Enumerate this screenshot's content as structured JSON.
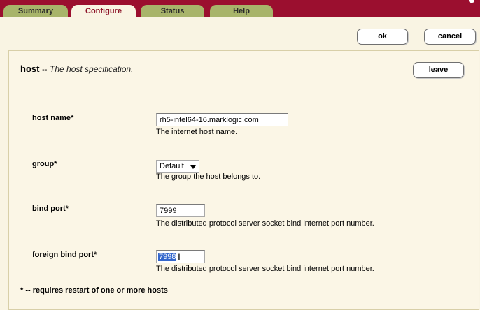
{
  "tabs": [
    {
      "label": "Summary",
      "active": false
    },
    {
      "label": "Configure",
      "active": true
    },
    {
      "label": "Status",
      "active": false
    },
    {
      "label": "Help",
      "active": false
    }
  ],
  "actions": {
    "ok_label": "ok",
    "cancel_label": "cancel",
    "leave_label": "leave"
  },
  "host": {
    "title": "host",
    "separator": "--",
    "description": "The host specification."
  },
  "fields": {
    "host_name": {
      "label": "host name*",
      "value": "rh5-intel64-16.marklogic.com",
      "help": "The internet host name."
    },
    "group": {
      "label": "group*",
      "value": "Default",
      "help": "The group the host belongs to."
    },
    "bind_port": {
      "label": "bind port*",
      "value": "7999",
      "help": "The distributed protocol server socket bind internet port number."
    },
    "foreign_bind_port": {
      "label": "foreign bind port*",
      "value": "7998",
      "help": "The distributed protocol server socket bind internet port number."
    }
  },
  "footnote": "* -- requires restart of one or more hosts",
  "colors": {
    "header_bar": "#9b0f2f",
    "tab_inactive": "#a8b46a",
    "background": "#f9f4e3",
    "selection": "#3366cc"
  }
}
